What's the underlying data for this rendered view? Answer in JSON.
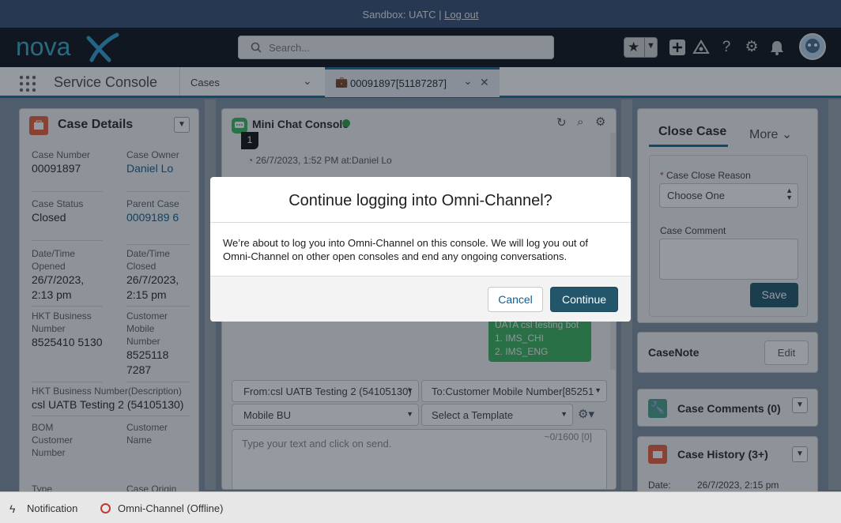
{
  "sandbox": {
    "prefix": "Sandbox: UATC |",
    "logout": "Log out"
  },
  "header": {
    "search_placeholder": "Search...",
    "logo_text": "novaX"
  },
  "nav": {
    "app_title": "Service Console",
    "cases_tab": "Cases",
    "case_tab": "00091897[51187287]"
  },
  "case_details": {
    "title": "Case Details",
    "fields": {
      "case_number_label": "Case Number",
      "case_number": "00091897",
      "case_owner_label": "Case Owner",
      "case_owner": "Daniel Lo",
      "case_status_label": "Case Status",
      "case_status": "Closed",
      "parent_case_label": "Parent Case",
      "parent_case": "0009189 6",
      "opened_label": "Date/Time Opened",
      "opened": "26/7/2023, 2:13 pm",
      "closed_label": "Date/Time Closed",
      "closed": "26/7/2023, 2:15 pm",
      "hkt_bn_label": "HKT Business Number",
      "hkt_bn": "8525410 5130",
      "cust_mobile_label": "Customer Mobile Number",
      "cust_mobile": "8525118 7287",
      "hkt_desc_label": "HKT Business Number(Description)",
      "hkt_desc": "csl UATB Testing 2 (54105130)",
      "bom_label": "BOM Customer Number",
      "cust_name_label": "Customer Name",
      "type_label": "Type",
      "origin_label": "Case Origin"
    }
  },
  "chat": {
    "title": "Mini Chat Console",
    "badge": "1",
    "meta": "26/7/2023, 1:52 PM at:Daniel Lo",
    "bubble": [
      "UATA csl testing bot",
      "1. IMS_CHI",
      "2. IMS_ENG"
    ],
    "from": "From:csl UATB Testing 2 (54105130)",
    "to": "To:Customer Mobile Number[85251",
    "bu": "Mobile BU",
    "template": "Select a Template",
    "counter": "~0/1600 [0]",
    "input_placeholder": "Type your text and click on send."
  },
  "right": {
    "tab_close": "Close Case",
    "tab_more": "More",
    "reason_label": "Case Close Reason",
    "reason_value": "Choose One",
    "comment_label": "Case Comment",
    "save": "Save",
    "casenote": "CaseNote",
    "edit": "Edit",
    "comments": "Case Comments (0)",
    "history": "Case History (3+)",
    "history_date_label": "Date:",
    "history_date": "26/7/2023, 2:15 pm"
  },
  "modal": {
    "title": "Continue logging into Omni-Channel?",
    "body": "We’re about to log you into Omni-Channel on this console. We will log you out of Omni-Channel on other open consoles and end any ongoing conversations.",
    "cancel": "Cancel",
    "continue": "Continue"
  },
  "footer": {
    "notification": "Notification",
    "omni": "Omni-Channel (Offline)"
  }
}
